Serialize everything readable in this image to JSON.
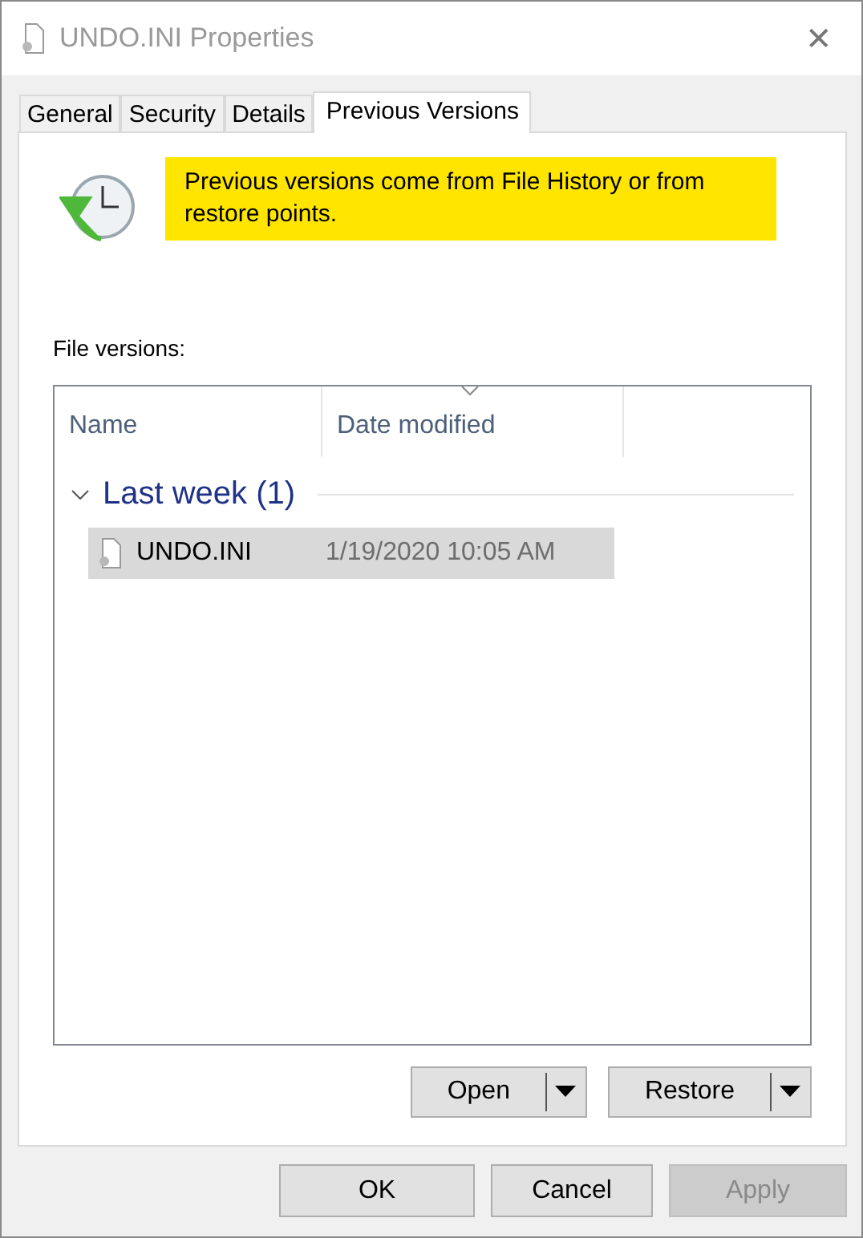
{
  "window": {
    "title": "UNDO.INI Properties",
    "close": "✕"
  },
  "tabs": [
    {
      "label": "General",
      "selected": false
    },
    {
      "label": "Security",
      "selected": false
    },
    {
      "label": "Details",
      "selected": false
    },
    {
      "label": "Previous Versions",
      "selected": true
    }
  ],
  "info": "Previous versions come from File History or from restore points.",
  "list_label": "File versions:",
  "columns": [
    "Name",
    "Date modified"
  ],
  "groups": [
    {
      "title": "Last week (1)",
      "expanded": true,
      "rows": [
        {
          "name": "UNDO.INI",
          "date": "1/19/2020 10:05 AM",
          "selected": true
        }
      ]
    }
  ],
  "actions": [
    {
      "label": "Open",
      "disabled": false
    },
    {
      "label": "Restore",
      "disabled": false
    }
  ],
  "buttons": [
    {
      "label": "OK",
      "disabled": false
    },
    {
      "label": "Cancel",
      "disabled": false
    },
    {
      "label": "Apply",
      "disabled": true
    }
  ]
}
